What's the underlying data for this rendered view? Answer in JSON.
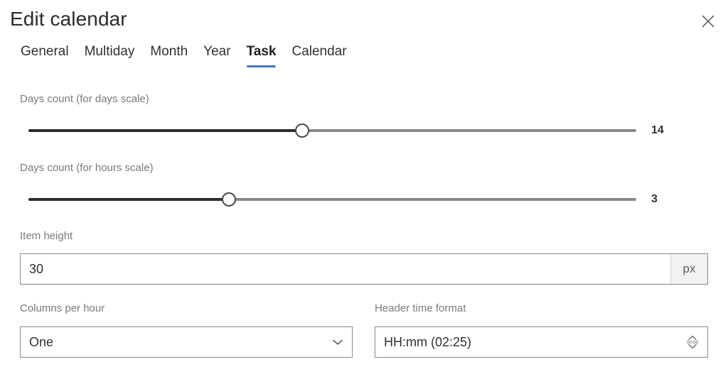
{
  "dialog": {
    "title": "Edit calendar",
    "close_label": "Close"
  },
  "theme": {
    "accent": "#3b79d0"
  },
  "tabs": [
    {
      "label": "General",
      "active": false
    },
    {
      "label": "Multiday",
      "active": false
    },
    {
      "label": "Month",
      "active": false
    },
    {
      "label": "Year",
      "active": false
    },
    {
      "label": "Task",
      "active": true
    },
    {
      "label": "Calendar",
      "active": false
    }
  ],
  "fields": {
    "days_count_days_scale": {
      "label": "Days count (for days scale)",
      "value": "14",
      "fill_percent": 45
    },
    "days_count_hours_scale": {
      "label": "Days count (for hours scale)",
      "value": "3",
      "fill_percent": 33
    },
    "item_height": {
      "label": "Item height",
      "value": "30",
      "placeholder": "",
      "suffix": "px"
    },
    "columns_per_hour": {
      "label": "Columns per hour",
      "value": "One",
      "icon": "chevron-down-icon"
    },
    "header_time_format": {
      "label": "Header time format",
      "value": "HH:mm (02:25)",
      "icon": "time-spinner-icon",
      "icon_text": "00:00"
    }
  }
}
